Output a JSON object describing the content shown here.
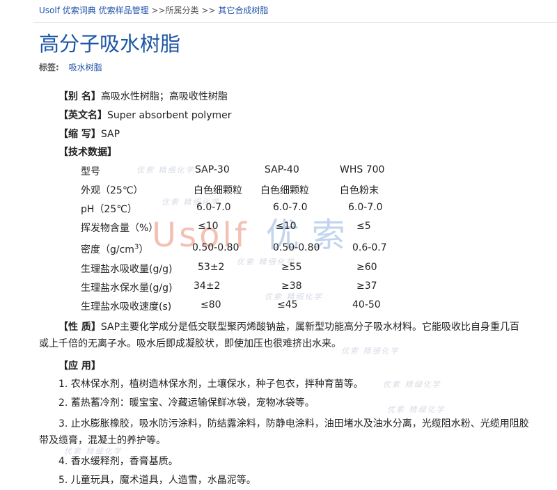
{
  "breadcrumb": {
    "items": [
      "Usolf 优索词典",
      "优索样品管理",
      "所属分类",
      "其它合成树脂"
    ],
    "separator": ">>"
  },
  "title": "高分子吸水树脂",
  "tags": {
    "label": "标签:",
    "items": [
      "吸水树脂"
    ]
  },
  "fields": [
    {
      "label": "【别  名】",
      "value": "高吸水性树脂；高吸收性树脂"
    },
    {
      "label": "【英文名】",
      "value": "Super absorbent polymer"
    },
    {
      "label": "【缩  写】",
      "value": "SAP"
    }
  ],
  "tech": {
    "label": "【技术数据】",
    "header": [
      "型号",
      "SAP-30",
      "SAP-40",
      "WHS 700"
    ],
    "rows": [
      [
        "外观（25℃）",
        "白色细颗粒",
        "白色细颗粒",
        "白色粉末"
      ],
      [
        "pH（25℃）",
        "6.0-7.0",
        "6.0-7.0",
        "6.0-7.0"
      ],
      [
        "挥发物含量（%）",
        "≤10",
        "≤10",
        "≤5"
      ],
      [
        "密度（g/cm",
        "0.50-0.80",
        "0.50-0.80",
        "0.6-0.7"
      ],
      [
        "生理盐水吸收量(g/g)",
        "53±2",
        "≥55",
        "≥60"
      ],
      [
        "生理盐水保水量(g/g)",
        "34±2",
        "≥38",
        "≥37"
      ],
      [
        "生理盐水吸收速度(s)",
        "≤80",
        "≤45",
        "40-50"
      ]
    ],
    "density_sup": "3",
    "density_close": "）"
  },
  "properties": {
    "label": "【性  质】",
    "line1": "SAP主要化学成分是低交联型聚丙烯酸钠盐，属新型功能高分子吸水材料。它能吸收比自身重几百",
    "line2": "或上千倍的无离子水。吸水后即成凝胶状，即使加压也很难挤出水来。"
  },
  "applications": {
    "label": "【应  用】",
    "items": [
      "1. 农林保水剂，植树造林保水剂，土壤保水，种子包衣，拌种育苗等。",
      "2. 蓄热蓄冷剂：暖宝宝、冷藏运输保鲜冰袋，宠物冰袋等。",
      "3. 止水膨胀橡胶，吸水防污涂料，防结露涂料，防静电涂料，油田堵水及油水分离，光缆阻水粉、光缆用阻胶",
      "带及缆膏，混凝土的养护等。",
      "4. 香水缓释剂，香膏基质。",
      "5. 儿童玩具，魔术道具，人造雪，水晶泥等。"
    ]
  },
  "watermark": {
    "latin": "Usolf",
    "cn": "优索",
    "small": "优索 精细化学"
  }
}
